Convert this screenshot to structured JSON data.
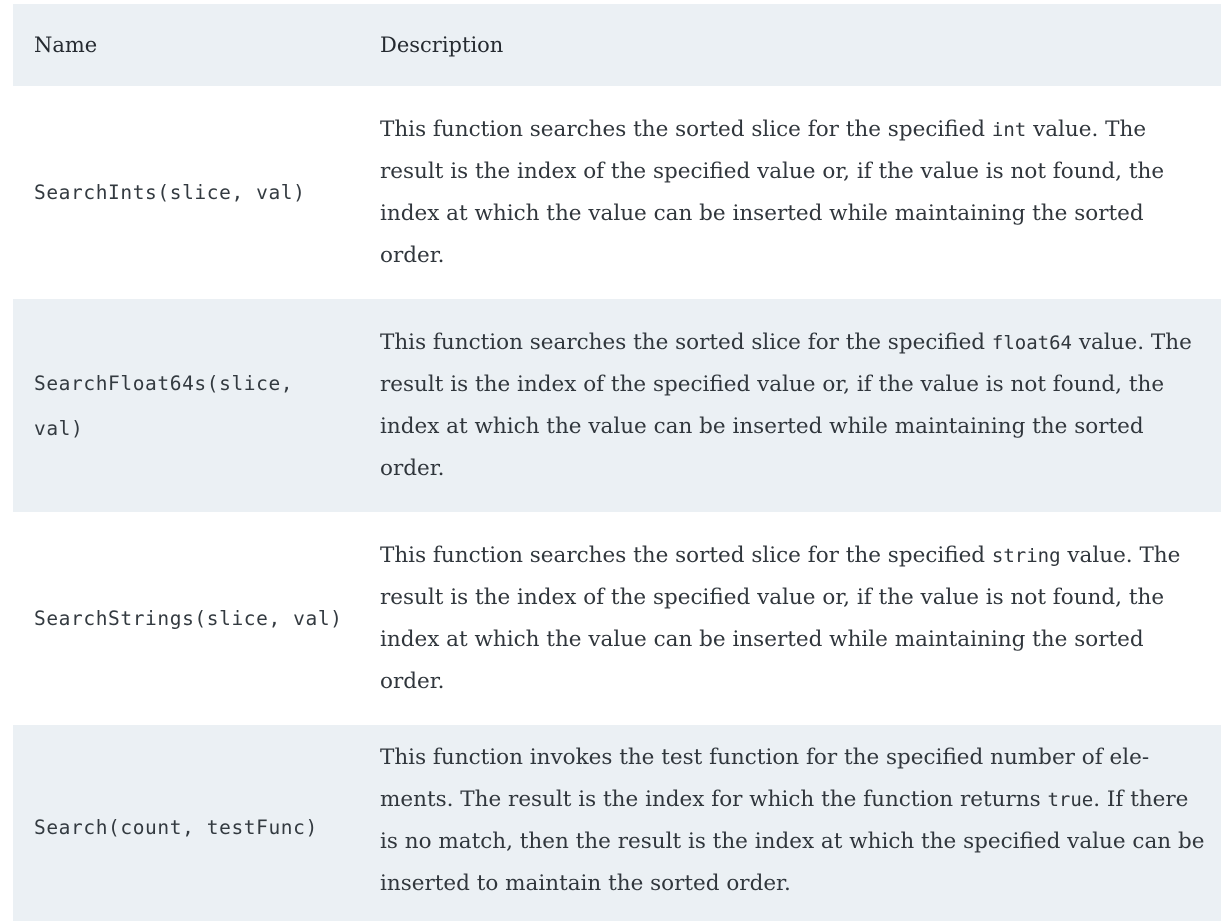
{
  "table": {
    "headers": {
      "name": "Name",
      "description": "Description"
    },
    "rows": [
      {
        "name": "SearchInts(slice, val)",
        "desc_before": "This function searches the sorted slice for the specified ",
        "desc_code": "int",
        "desc_after": " value. The result is the index of the specified value or, if the value is not found, the index at which the value can be inserted while maintaining the sorted order."
      },
      {
        "name": "SearchFloat64s(slice, val)",
        "desc_before": "This function searches the sorted slice for the specified ",
        "desc_code": "float64",
        "desc_after": " value. The result is the index of the specified value or, if the value is not found, the index at which the value can be inserted while maintaining the sorted order."
      },
      {
        "name": "SearchStrings(slice, val)",
        "desc_before": "This function searches the sorted slice for the specified ",
        "desc_code": "string",
        "desc_after": " value. The result is the index of the specified value or, if the value is not found, the index at which the value can be inserted while maintaining the sorted order."
      },
      {
        "name": "Search(count, testFunc)",
        "desc_before": "This function invokes the test function for the specified number of ele-ments. The result is the index for which the function returns ",
        "desc_code": "true",
        "desc_after": ". If there is no match, then the result is the index at which the specified value can be inserted to maintain the sorted order."
      }
    ]
  },
  "colors": {
    "shaded_row": "#ebf0f4",
    "text": "#30363c"
  }
}
